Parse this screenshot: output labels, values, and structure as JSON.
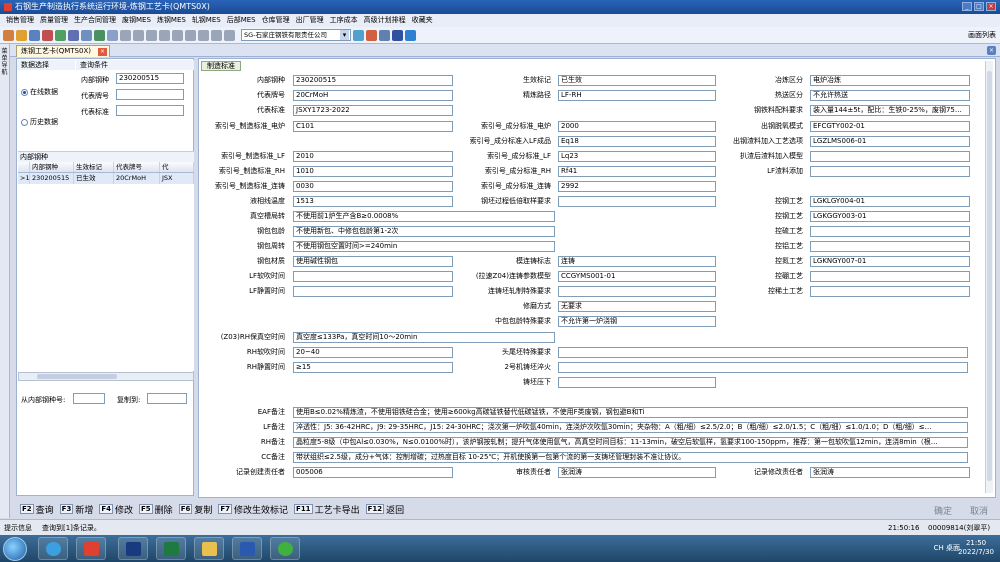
{
  "window": {
    "title": "石钢生产制造执行系统运行环境-炼钢工艺卡(QMTS0X)"
  },
  "menu": [
    "销售管理",
    "质量管理",
    "生产合同管理",
    "废钢MES",
    "炼钢MES",
    "轧钢MES",
    "后部MES",
    "仓库管理",
    "出厂管理",
    "工序成本",
    "高级计划排程",
    "收藏夹"
  ],
  "toolbar": {
    "company": "SG-石家庄钢铁有限责任公司",
    "screen_list": "画面列表"
  },
  "doc_tab": {
    "label": "炼钢工艺卡(QMTS0X)"
  },
  "left_strip": "菜单导航",
  "query": {
    "section_select": "数据选择",
    "section_condition": "查询条件",
    "radio_online": "在线数据",
    "radio_history": "历史数据",
    "label_internal": "内部钢种",
    "value_internal": "230200515",
    "label_rep_grade": "代表牌号",
    "value_rep_grade": "",
    "label_rep_std": "代表标准",
    "value_rep_std": ""
  },
  "grid": {
    "title": "内部钢种",
    "headers": [
      "",
      "内部钢种",
      "生效标记",
      "代表牌号",
      "代"
    ],
    "rows": [
      [
        ">1",
        "230200515",
        "已生效",
        "20CrMoH",
        "JSX"
      ]
    ]
  },
  "copy": {
    "from_label": "从内部钢种号:",
    "to_label": "复制到:"
  },
  "form": {
    "tab": "制造标准",
    "internal_grade": {
      "label": "内部钢种",
      "value": "230200515"
    },
    "rep_grade": {
      "label": "代表牌号",
      "value": "20CrMoH"
    },
    "rep_std": {
      "label": "代表标准",
      "value": "JSXY1723-2022"
    },
    "idx_mfg_ef": {
      "label": "索引号_制造标准_电炉",
      "value": "C101"
    },
    "idx_mfg_lf": {
      "label": "索引号_制造标准_LF",
      "value": "2010"
    },
    "idx_mfg_rh": {
      "label": "索引号_制造标准_RH",
      "value": "1010"
    },
    "idx_mfg_cc": {
      "label": "索引号_制造标准_连铸",
      "value": "0030"
    },
    "liquidus": {
      "label": "液相线温度",
      "value": "1513"
    },
    "vac_ratio": {
      "label": "真空槽局转",
      "value": "不使用前1炉生产含B≥0.0008%"
    },
    "ladle_pack": {
      "label": "钢包包龄",
      "value": "不使用新包、中修包包龄第1-2次"
    },
    "ladle_turn": {
      "label": "钢包周转",
      "value": "不使用钢包空置时间>=240min"
    },
    "ladle_mat": {
      "label": "钢包材质",
      "value": "使用碱性钢包"
    },
    "lf_blow": {
      "label": "LF软吹时间",
      "value": ""
    },
    "lf_static": {
      "label": "LF静置时间",
      "value": ""
    },
    "z03_rh": {
      "label": "(Z03)RH保真空时间",
      "value": "真空度≤133Pa，真空时间10～20min"
    },
    "rh_blow": {
      "label": "RH软吹时间",
      "value": "20~40"
    },
    "rh_static": {
      "label": "RH静置时间",
      "value": "≥15"
    },
    "eff_mark": {
      "label": "生效标记",
      "value": "已生效"
    },
    "route": {
      "label": "精炼路径",
      "value": "LF-RH"
    },
    "idx_comp_ef": {
      "label": "索引号_成分标准_电炉",
      "value": "2000"
    },
    "idx_comp_lf_in": {
      "label": "索引号_成分标准入LF成品",
      "value": "Eq18"
    },
    "idx_comp_lf": {
      "label": "索引号_成分标准_LF",
      "value": "Lq23"
    },
    "idx_comp_rh": {
      "label": "索引号_成分标准_RH",
      "value": "Rf41"
    },
    "idx_comp_cc": {
      "label": "索引号_成分标准_连铸",
      "value": "2992"
    },
    "low_temp_req": {
      "label": "钢坯过程低倍取样要求",
      "value": ""
    },
    "cc_mark": {
      "label": "模连铸标志",
      "value": "连铸"
    },
    "z04_mold": {
      "label": "(拉速Z04)连铸参数模型",
      "value": "CCGYMS001-01"
    },
    "cc_emag": {
      "label": "连铸坯轧制特殊要求",
      "value": ""
    },
    "repair": {
      "label": "修磨方式",
      "value": "无要求"
    },
    "tundish": {
      "label": "中包包龄特殊要求",
      "value": "不允许第一炉浇钢"
    },
    "head_tail": {
      "label": "头尾坯特殊要求",
      "value": ""
    },
    "no2_water": {
      "label": "2号机铸坯淬火",
      "value": ""
    },
    "sf_press": {
      "label": "铸坯压下",
      "value": ""
    },
    "smelt_area": {
      "label": "冶炼区分",
      "value": "电炉冶炼"
    },
    "heat_area": {
      "label": "热送区分",
      "value": "不允许热送"
    },
    "material": {
      "label": "钢铁料配料要求",
      "value": "装入量144±5t，配比：生铁0-25%，废钢75…"
    },
    "tap_deox": {
      "label": "出钢脱氧模式",
      "value": "EFCGTY002-01"
    },
    "tap_lf_alloy": {
      "label": "出钢渣料加入工艺选项",
      "value": "LGZLMS006-01"
    },
    "lf_after_model": {
      "label": "扒渣后渣料加入模型",
      "value": ""
    },
    "lf_add": {
      "label": "LF渣料添加",
      "value": ""
    },
    "ctrl1": {
      "label": "控钢工艺",
      "value": "LGKLGY004-01"
    },
    "ctrl2": {
      "label": "控钢工艺",
      "value": "LGKGGY003-01"
    },
    "ctrl3": {
      "label": "控硫工艺",
      "value": ""
    },
    "ctrl4": {
      "label": "控铝工艺",
      "value": ""
    },
    "ctrl5": {
      "label": "控氮工艺",
      "value": "LGKNGY007-01"
    },
    "ctrl6": {
      "label": "控硼工艺",
      "value": ""
    },
    "ctrl7": {
      "label": "控稀土工艺",
      "value": ""
    },
    "eaf_note": {
      "label": "EAF备注",
      "value": "使用B≤0.02%精炼渣，不使用钼铁硅合金；使用≥600kg高碳锰铁替代低碳锰铁，不使用F类废钢，钢包避B和Ti"
    },
    "lf_note": {
      "label": "LF备注",
      "value": "淬透性：J5: 36-42HRC，J9: 29-35HRC，J15: 24-30HRC；浇次第一炉吹氩40min，连浇炉次吹氩30min；夹杂物：A（粗/细）≤2.5/2.0；B（粗/细）≤2.0/1.5；C（粗/细）≤1.0/1.0；D（粗/细）≤…"
    },
    "rh_note": {
      "label": "RH备注",
      "value": "晶粒度5-8级（中包Al≤0.030%，N≤0.0100%时），该炉钢按轧制；提升气体使用氩气，高真空时间目标：11-13min，破空后软氩样，氢要求100-150ppm，推荐：第一包软吹氩12min，连浇8min（根…"
    },
    "cc_note": {
      "label": "CC备注",
      "value": "带状组织≤2.5级，成分+气体：控制增碳；过热度目标 10-25℃；开机使换第一包第个流的第一支铸坯管理封装不准让协议。"
    },
    "creator": {
      "label": "记录创建责任者",
      "value": "005006"
    },
    "reviewer": {
      "label": "审核责任者",
      "value": "张润涛"
    },
    "modifier": {
      "label": "记录修改责任者",
      "value": "张润涛"
    }
  },
  "fkeys": [
    {
      "key": "F2",
      "label": "查询"
    },
    {
      "key": "F3",
      "label": "新增"
    },
    {
      "key": "F4",
      "label": "修改"
    },
    {
      "key": "F5",
      "label": "删除"
    },
    {
      "key": "F6",
      "label": "复制"
    },
    {
      "key": "F7",
      "label": "修改生效标记"
    },
    {
      "key": "F11",
      "label": "工艺卡导出"
    },
    {
      "key": "F12",
      "label": "返回"
    }
  ],
  "fkeys_right": {
    "confirm": "确定",
    "cancel": "取消"
  },
  "status": {
    "label": "提示信息",
    "message": "查询到[1]条记录。",
    "time": "21:50:16",
    "user": "00009814(刘翠平)"
  },
  "taskbar": {
    "time": "21:50",
    "date": "2022/7/30",
    "tray_text": "CH",
    "desktop": "桌面"
  },
  "colors": {
    "title": "#1a4a94",
    "accent": "#2a64b8",
    "grid_selected": "#dfe9f8"
  }
}
